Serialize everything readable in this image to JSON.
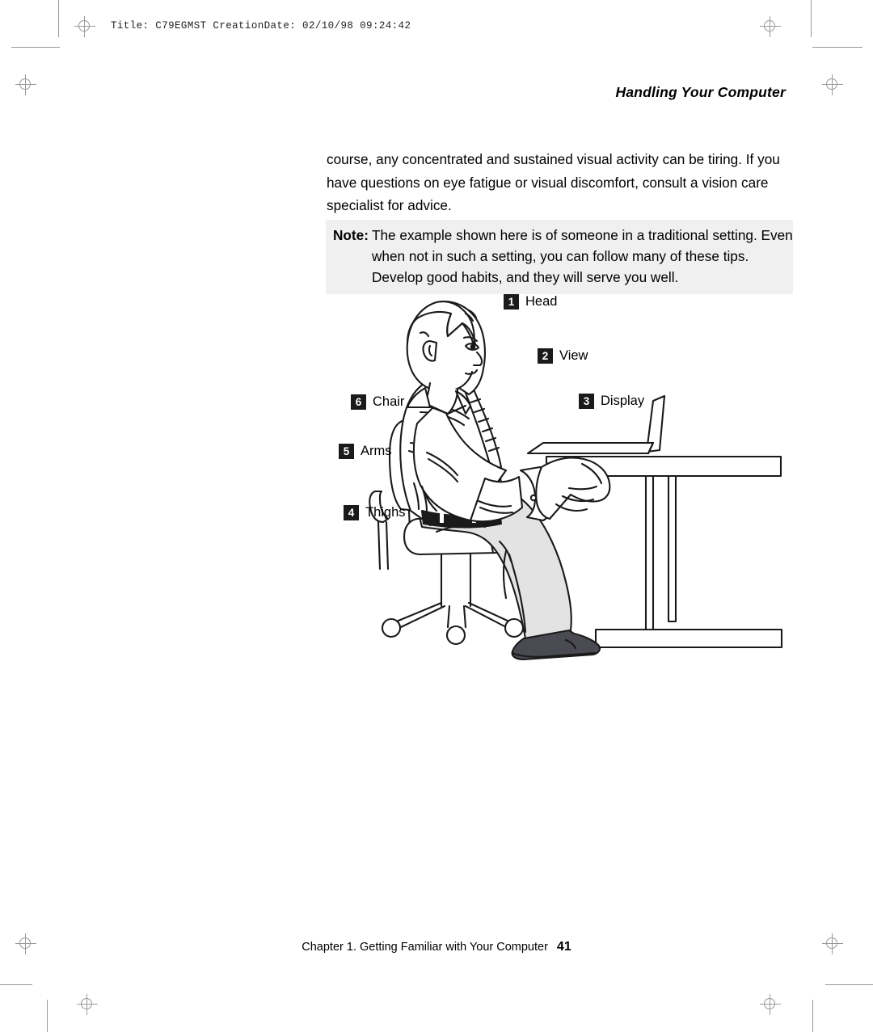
{
  "print_marks": {
    "job_line": "Title: C79EGMST CreationDate: 02/10/98 09:24:42"
  },
  "header": {
    "running_head": "Handling Your Computer"
  },
  "body": {
    "paragraph": "course, any concentrated and sustained visual activity can be tiring. If you have questions on eye fatigue or visual discomfort, consult a vision care specialist for advice."
  },
  "note": {
    "label": "Note:",
    "line1": "The example shown here is of someone in a traditional setting.  Even",
    "line2": "when not in such a setting, you can follow many of these tips.",
    "line3": "Develop good habits, and they will serve you well."
  },
  "figure": {
    "description": "Line drawing of a person seated at a desk using a notebook computer, with numbered callouts",
    "callouts": [
      {
        "number": "1",
        "label": "Head"
      },
      {
        "number": "2",
        "label": "View"
      },
      {
        "number": "3",
        "label": "Display"
      },
      {
        "number": "4",
        "label": "Thighs"
      },
      {
        "number": "5",
        "label": "Arms"
      },
      {
        "number": "6",
        "label": "Chair"
      }
    ]
  },
  "footer": {
    "chapter": "Chapter 1.  Getting Familiar with Your Computer",
    "page_number": "41"
  },
  "colors": {
    "note_background": "#f0f0f0",
    "callout_badge": "#1a1a1a",
    "ink": "#000000",
    "mark_gray": "#999999",
    "garment_fill": "#e3e3e3",
    "shoe_fill": "#4a4a52"
  }
}
